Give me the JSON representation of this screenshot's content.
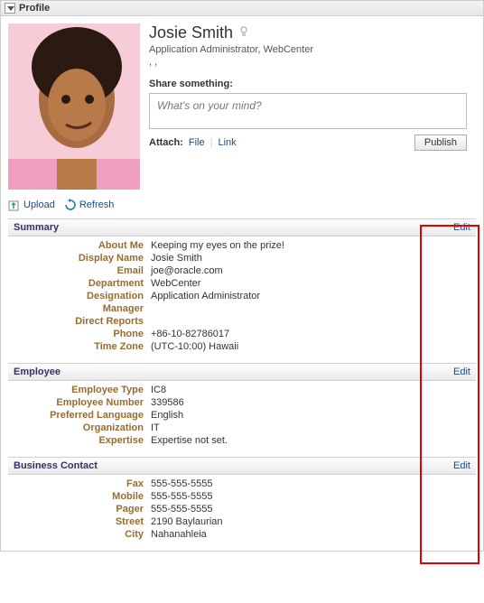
{
  "panel": {
    "title": "Profile"
  },
  "person": {
    "name": "Josie Smith",
    "title": "Application Administrator, WebCenter",
    "subtitle": ", ,"
  },
  "share": {
    "label": "Share something:",
    "placeholder": "What's on your mind?",
    "attach_label": "Attach:",
    "file": "File",
    "link": "Link",
    "publish": "Publish"
  },
  "actions": {
    "upload": "Upload",
    "refresh": "Refresh"
  },
  "sections": {
    "summary": {
      "title": "Summary",
      "edit": "Edit",
      "rows": [
        {
          "label": "About Me",
          "value": "Keeping my eyes on the prize!"
        },
        {
          "label": "Display Name",
          "value": "Josie Smith"
        },
        {
          "label": "Email",
          "value": "joe@oracle.com"
        },
        {
          "label": "Department",
          "value": "WebCenter"
        },
        {
          "label": "Designation",
          "value": "Application Administrator"
        },
        {
          "label": "Manager",
          "value": ""
        },
        {
          "label": "Direct Reports",
          "value": ""
        },
        {
          "label": "Phone",
          "value": "+86-10-82786017"
        },
        {
          "label": "Time Zone",
          "value": "(UTC-10:00) Hawaii"
        }
      ]
    },
    "employee": {
      "title": "Employee",
      "edit": "Edit",
      "rows": [
        {
          "label": "Employee Type",
          "value": "IC8"
        },
        {
          "label": "Employee Number",
          "value": "339586"
        },
        {
          "label": "Preferred Language",
          "value": "English"
        },
        {
          "label": "Organization",
          "value": "IT"
        },
        {
          "label": "Expertise",
          "value": "Expertise not set."
        }
      ]
    },
    "business": {
      "title": "Business Contact",
      "edit": "Edit",
      "rows": [
        {
          "label": "Fax",
          "value": "555-555-5555"
        },
        {
          "label": "Mobile",
          "value": "555-555-5555"
        },
        {
          "label": "Pager",
          "value": "555-555-5555"
        },
        {
          "label": "Street",
          "value": "2190 Baylaurian"
        },
        {
          "label": "City",
          "value": "Nahanahleia"
        }
      ]
    }
  }
}
